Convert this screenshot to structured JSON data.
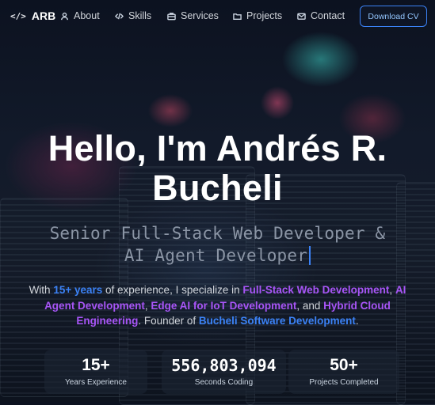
{
  "nav": {
    "brand": "ARB",
    "items": [
      {
        "label": "About",
        "icon": "user-icon"
      },
      {
        "label": "Skills",
        "icon": "code-icon"
      },
      {
        "label": "Services",
        "icon": "briefcase-icon"
      },
      {
        "label": "Projects",
        "icon": "folder-icon"
      },
      {
        "label": "Contact",
        "icon": "mail-icon"
      }
    ],
    "cta": "Download CV"
  },
  "hero": {
    "title_line1": "Hello, I'm Andrés R.",
    "title_line2": "Bucheli",
    "subtitle_line1": "Senior Full-Stack Web Developer &",
    "subtitle_line2": "AI Agent Developer",
    "intro": {
      "t1": "With ",
      "h1": "15+ years",
      "t2": " of experience, I specialize in ",
      "h2": "Full-Stack Web Development",
      "t3": ", ",
      "h3": "AI Agent Development",
      "t4": ", ",
      "h4": "Edge AI for IoT Development",
      "t5": ", and ",
      "h5": "Hybrid Cloud Engineering",
      "t6": ". Founder of ",
      "h6": "Bucheli Software Development",
      "t7": "."
    }
  },
  "stats": [
    {
      "value": "15+",
      "label": "Years Experience"
    },
    {
      "value": "556,803,094",
      "label": "Seconds Coding"
    },
    {
      "value": "50+",
      "label": "Projects Completed"
    }
  ],
  "colors": {
    "accent_blue": "#3b82f6",
    "accent_purple": "#a855f7",
    "background": "#121a2a"
  }
}
